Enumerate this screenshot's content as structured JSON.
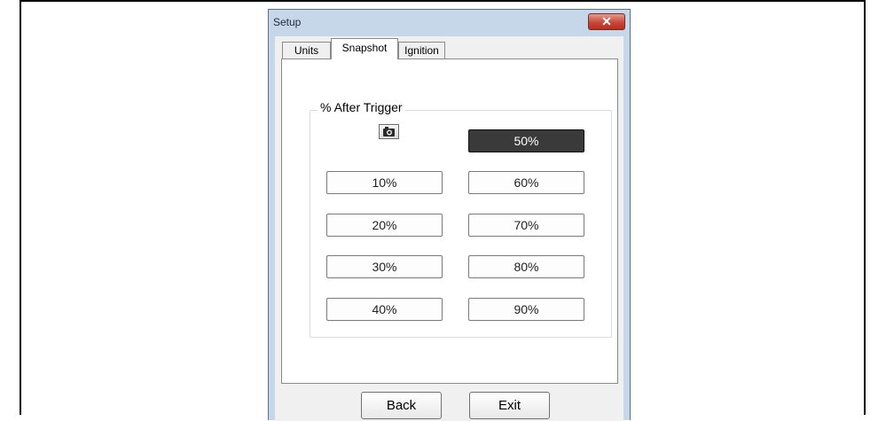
{
  "window": {
    "title": "Setup",
    "close_label": "✕"
  },
  "tabs": [
    {
      "label": "Units",
      "active": false
    },
    {
      "label": "Snapshot",
      "active": true
    },
    {
      "label": "Ignition",
      "active": false
    }
  ],
  "group": {
    "label": "% After Trigger",
    "camera_icon": "camera-icon"
  },
  "percent_buttons": {
    "p10": "10%",
    "p20": "20%",
    "p30": "30%",
    "p40": "40%",
    "p50": "50%",
    "p60": "60%",
    "p70": "70%",
    "p80": "80%",
    "p90": "90%",
    "selected": "50%"
  },
  "footer": {
    "back_label": "Back",
    "exit_label": "Exit"
  },
  "colors": {
    "window_frame": "#c7d7ea",
    "close_button": "#c9473a",
    "selected_button": "#3a3a3a"
  }
}
